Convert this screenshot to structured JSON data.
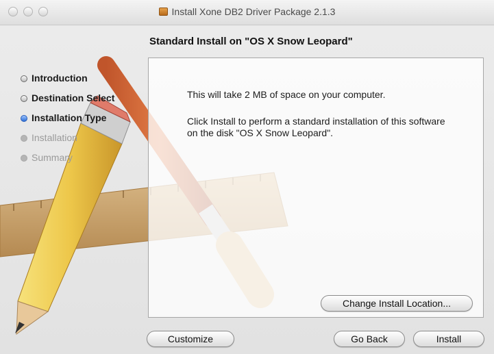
{
  "window": {
    "title": "Install Xone DB2 Driver Package 2.1.3"
  },
  "heading": "Standard Install on \"OS X Snow Leopard\"",
  "steps": [
    {
      "label": "Introduction",
      "state": "done"
    },
    {
      "label": "Destination Select",
      "state": "done"
    },
    {
      "label": "Installation Type",
      "state": "current"
    },
    {
      "label": "Installation",
      "state": "pending"
    },
    {
      "label": "Summary",
      "state": "pending"
    }
  ],
  "body": {
    "space": "This will take 2 MB of space on your computer.",
    "instruction": "Click Install to perform a standard installation of this software on the disk \"OS X Snow Leopard\"."
  },
  "buttons": {
    "change_location": "Change Install Location...",
    "customize": "Customize",
    "go_back": "Go Back",
    "install": "Install"
  },
  "icons": {
    "title_icon": "package-icon",
    "background": "pencil-brush-ruler-illustration"
  }
}
